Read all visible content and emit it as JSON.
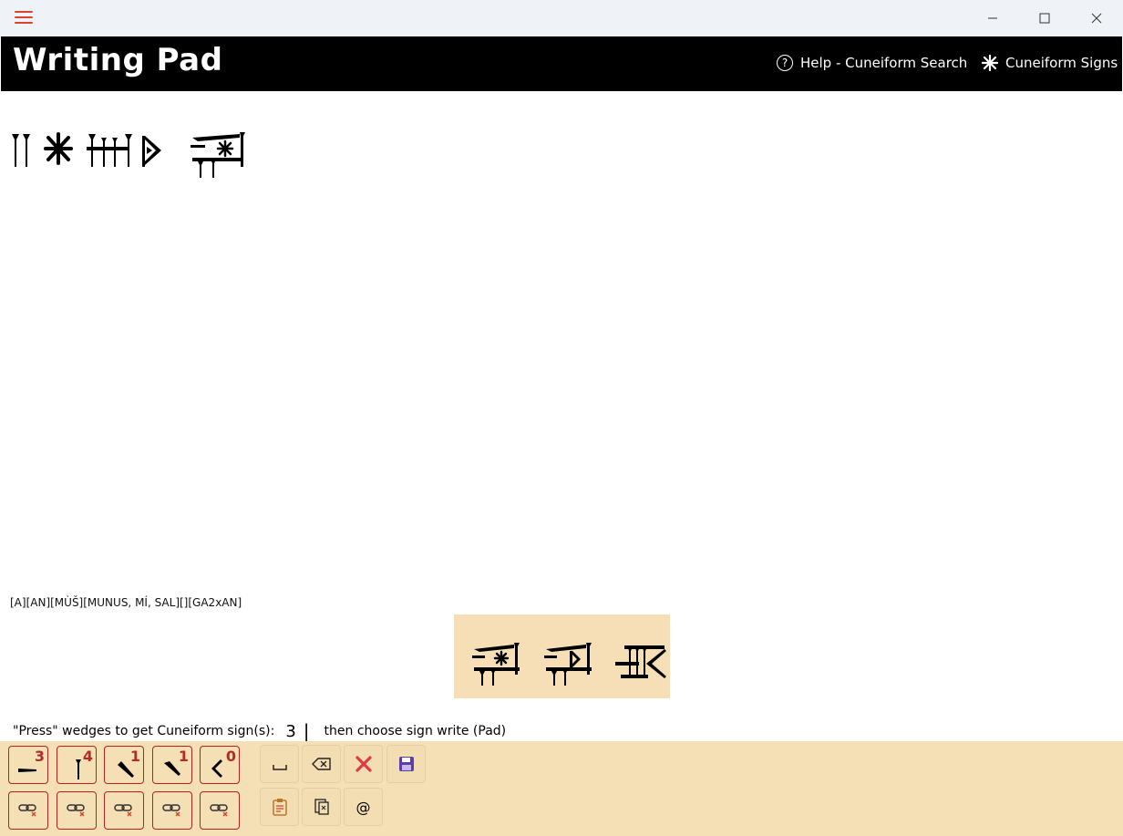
{
  "window": {
    "menu_icon": "hamburger-icon",
    "controls": [
      "minimize-icon",
      "maximize-icon",
      "close-icon"
    ]
  },
  "header": {
    "title": "Writing Pad",
    "help_label": "Help - Cuneiform Search",
    "signs_label": "Cuneiform Signs"
  },
  "pad": {
    "glyph_line": "cuneiform signs: A AN MUŠ MUNUS GA2xAN",
    "transliteration": "[A][AN][MÙŠ][MUNUS, MÍ, SAL][][GA2xAN]"
  },
  "candidates": [
    "cuneiform sign 1",
    "cuneiform sign 2",
    "cuneiform sign 3"
  ],
  "prompt": {
    "before": "\"Press\" wedges to get Cuneiform sign(s):",
    "count": "3",
    "caret": "|",
    "after": "then choose sign write (Pad)"
  },
  "wedges": [
    {
      "icon": "horizontal-wedge-icon",
      "count": "3"
    },
    {
      "icon": "vertical-wedge-icon",
      "count": "4"
    },
    {
      "icon": "diagonal-down-wedge-icon",
      "count": "1"
    },
    {
      "icon": "diagonal-up-wedge-icon",
      "count": "1"
    },
    {
      "icon": "winkelhaken-icon",
      "count": "0"
    }
  ],
  "tools": [
    "space-icon",
    "backspace-icon",
    "clear-icon",
    "save-icon",
    "paste-icon",
    "copy-icon",
    "at-icon"
  ],
  "colors": {
    "accent": "#d9442a",
    "header_bg": "#000000",
    "panel_bg": "#f5dfb5",
    "wedge_border": "#b02323",
    "wedge_count": "#b22b2b",
    "clear_icon": "#e0394a",
    "save_icon": "#5b3ea8"
  }
}
